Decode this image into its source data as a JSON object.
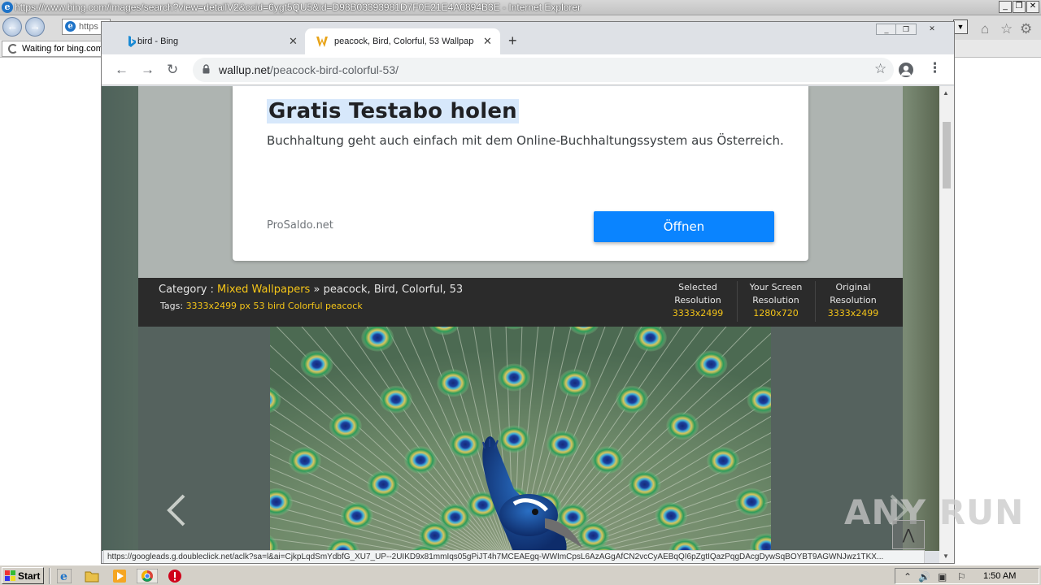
{
  "ie": {
    "title": "https://www.bing.com/images/search?view=detailV2&ccid=6ygt5QU5&id=D98B03393981D7F0E21E4A0894B3E - Internet Explorer",
    "address_value": "https",
    "tab_label": "Waiting for bing.com"
  },
  "chrome": {
    "tabs": [
      {
        "label": "bird - Bing",
        "icon": "bing-icon",
        "active": false
      },
      {
        "label": "peacock, Bird, Colorful, 53 Wallpaper",
        "icon": "wallup-icon",
        "active": true
      }
    ],
    "url_domain": "wallup.net",
    "url_path": "/peacock-bird-colorful-53/",
    "status_url": "https://googleads.g.doubleclick.net/aclk?sa=l&ai=CjkpLqdSmYdbfG_XU7_UP--2UIKD9x81mmIqs05gPiJT4h7MCEAEgq-WWImCpsL6AzAGgAfCN2vcCyAEBqQI6pZgtIQazPqgDAcgDywSqBOYBT9AGWNJwz1TKX..."
  },
  "ad": {
    "headline": "Gratis Testabo holen",
    "description": "Buchhaltung geht auch einfach mit dem Online-Buchhaltungssystem aus Österreich.",
    "domain": "ProSaldo.net",
    "button_label": "Öffnen"
  },
  "category": {
    "prefix": "Category : ",
    "category_link": "Mixed Wallpapers",
    "separator": " » ",
    "title": "peacock, Bird, Colorful, 53",
    "tags_prefix": "Tags: ",
    "tags": "3333x2499 px 53 bird Colorful peacock",
    "resolutions": [
      {
        "label1": "Selected",
        "label2": "Resolution",
        "value": "3333x2499"
      },
      {
        "label1": "Your Screen",
        "label2": "Resolution",
        "value": "1280x720"
      },
      {
        "label1": "Original",
        "label2": "Resolution",
        "value": "3333x2499"
      }
    ]
  },
  "watermark": "ANY RUN",
  "taskbar": {
    "start_label": "Start",
    "clock": "1:50 AM"
  },
  "colors": {
    "accent_blue": "#0a84ff",
    "link_yellow": "#f5c518",
    "category_bar": "#2b2b2b"
  }
}
